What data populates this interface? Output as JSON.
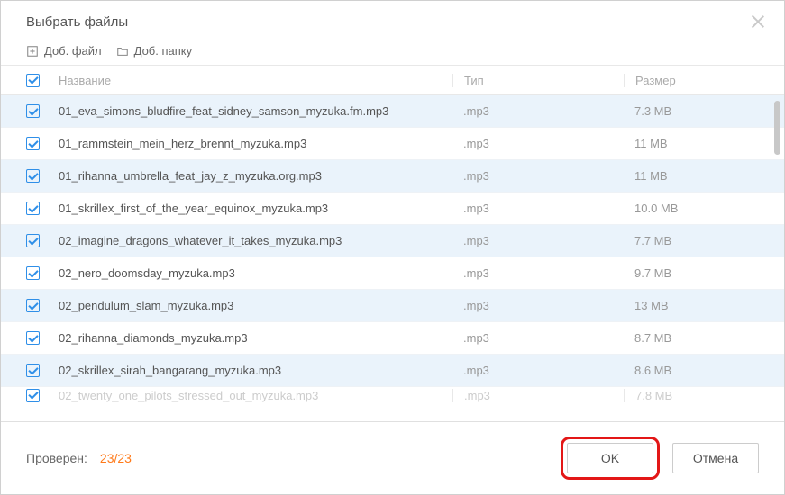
{
  "title": "Выбрать файлы",
  "toolbar": {
    "add_file": "Доб. файл",
    "add_folder": "Доб. папку"
  },
  "headers": {
    "name": "Название",
    "type": "Тип",
    "size": "Размер"
  },
  "rows": [
    {
      "name": "01_eva_simons_bludfire_feat_sidney_samson_myzuka.fm.mp3",
      "type": ".mp3",
      "size": "7.3 MB",
      "alt": true
    },
    {
      "name": "01_rammstein_mein_herz_brennt_myzuka.mp3",
      "type": ".mp3",
      "size": "11 MB",
      "alt": false
    },
    {
      "name": "01_rihanna_umbrella_feat_jay_z_myzuka.org.mp3",
      "type": ".mp3",
      "size": "11 MB",
      "alt": true
    },
    {
      "name": "01_skrillex_first_of_the_year_equinox_myzuka.mp3",
      "type": ".mp3",
      "size": "10.0 MB",
      "alt": false
    },
    {
      "name": "02_imagine_dragons_whatever_it_takes_myzuka.mp3",
      "type": ".mp3",
      "size": "7.7 MB",
      "alt": true
    },
    {
      "name": "02_nero_doomsday_myzuka.mp3",
      "type": ".mp3",
      "size": "9.7 MB",
      "alt": false
    },
    {
      "name": "02_pendulum_slam_myzuka.mp3",
      "type": ".mp3",
      "size": "13 MB",
      "alt": true
    },
    {
      "name": "02_rihanna_diamonds_myzuka.mp3",
      "type": ".mp3",
      "size": "8.7 MB",
      "alt": false
    },
    {
      "name": "02_skrillex_sirah_bangarang_myzuka.mp3",
      "type": ".mp3",
      "size": "8.6 MB",
      "alt": true
    }
  ],
  "partial_row": {
    "name": "02_twenty_one_pilots_stressed_out_myzuka.mp3",
    "type": ".mp3",
    "size": "7.8 MB"
  },
  "footer": {
    "checked_label": "Проверен:",
    "checked_count": "23/23",
    "ok": "OK",
    "cancel": "Отмена"
  }
}
